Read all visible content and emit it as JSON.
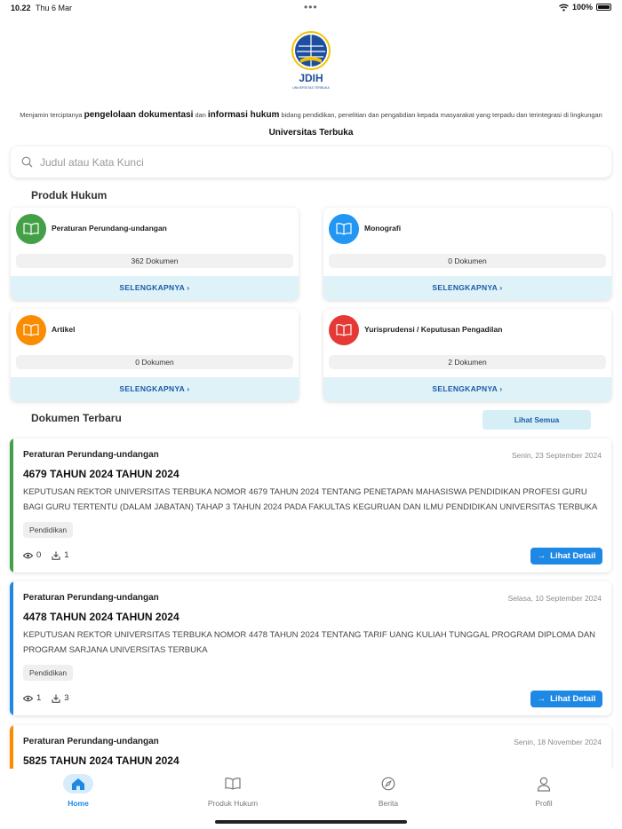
{
  "status_bar": {
    "time": "10.22",
    "date": "Thu 6 Mar",
    "battery": "100%"
  },
  "logo": {
    "text": "JDIH",
    "subtext": "UNIVERSITAS TERBUKA"
  },
  "tagline": {
    "part1": "Menjamin terciptanya ",
    "bold1": "pengelolaan dokumentasi",
    "part2": " dan ",
    "bold2": "informasi hukum",
    "part3": " bidang pendidikan, penelitian dan pengabdian kepada masyarakat yang terpadu dan terintegrasi di lingkungan",
    "institution": "Universitas Terbuka"
  },
  "search": {
    "placeholder": "Judul atau Kata Kunci"
  },
  "produk_hukum": {
    "title": "Produk Hukum",
    "more_label": "SELENGKAPNYA ›",
    "cards": [
      {
        "name": "Peraturan Perundang-undangan",
        "count": "362 Dokumen",
        "color": "#43a047"
      },
      {
        "name": "Monografi",
        "count": "0 Dokumen",
        "color": "#2196f3"
      },
      {
        "name": "Artikel",
        "count": "0 Dokumen",
        "color": "#fb8c00"
      },
      {
        "name": "Yurisprudensi / Keputusan Pengadilan",
        "count": "2 Dokumen",
        "color": "#e53935"
      }
    ]
  },
  "dokumen_terbaru": {
    "title": "Dokumen Terbaru",
    "see_all": "Lihat Semua",
    "detail_label": "Lihat Detail",
    "items": [
      {
        "category": "Peraturan Perundang-undangan",
        "date": "Senin, 23 September 2024",
        "title": "4679 TAHUN 2024 TAHUN 2024",
        "description": "KEPUTUSAN REKTOR UNIVERSITAS TERBUKA NOMOR 4679 TAHUN 2024 TENTANG PENETAPAN MAHASISWA PENDIDIKAN PROFESI GURU BAGI GURU TERTENTU (DALAM JABATAN) TAHAP 3 TAHUN 2024 PADA FAKULTAS KEGURUAN DAN ILMU PENDIDIKAN UNIVERSITAS TERBUKA",
        "tag": "Pendidikan",
        "views": "0",
        "downloads": "1",
        "accent": "#43a047"
      },
      {
        "category": "Peraturan Perundang-undangan",
        "date": "Selasa, 10 September 2024",
        "title": "4478 TAHUN 2024 TAHUN 2024",
        "description": "KEPUTUSAN REKTOR UNIVERSITAS TERBUKA NOMOR 4478 TAHUN 2024 TENTANG TARIF UANG KULIAH TUNGGAL PROGRAM DIPLOMA DAN PROGRAM SARJANA UNIVERSITAS TERBUKA",
        "tag": "Pendidikan",
        "views": "1",
        "downloads": "3",
        "accent": "#1e88e5"
      },
      {
        "category": "Peraturan Perundang-undangan",
        "date": "Senin, 18 November 2024",
        "title": "5825 TAHUN 2024 TAHUN 2024",
        "accent": "#fb8c00"
      }
    ]
  },
  "tabbar": {
    "items": [
      {
        "label": "Home",
        "icon": "home-icon",
        "active": true
      },
      {
        "label": "Produk Hukum",
        "icon": "book-icon",
        "active": false
      },
      {
        "label": "Berita",
        "icon": "compass-icon",
        "active": false
      },
      {
        "label": "Profil",
        "icon": "user-icon",
        "active": false
      }
    ]
  }
}
